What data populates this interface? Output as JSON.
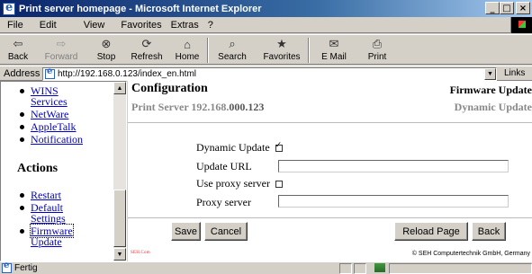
{
  "window": {
    "title": "Print server homepage - Microsoft Internet Explorer",
    "min_glyph": "_",
    "max_glyph": "□",
    "close_glyph": "×"
  },
  "menu": [
    "File",
    "Edit",
    "View",
    "Favorites",
    "Extras",
    "?"
  ],
  "toolbar": [
    {
      "label": "Back",
      "icon": "back-arrow-icon",
      "glyph": "⇦"
    },
    {
      "label": "Forward",
      "icon": "forward-arrow-icon",
      "glyph": "⇨",
      "disabled": true
    },
    {
      "label": "Stop",
      "icon": "stop-icon",
      "glyph": "⊗"
    },
    {
      "label": "Refresh",
      "icon": "refresh-icon",
      "glyph": "⟳"
    },
    {
      "label": "Home",
      "icon": "home-icon",
      "glyph": "⌂"
    },
    {
      "label": "Search",
      "icon": "search-icon",
      "glyph": "⌕"
    },
    {
      "label": "Favorites",
      "icon": "favorites-icon",
      "glyph": "★"
    },
    {
      "label": "E Mail",
      "icon": "mail-icon",
      "glyph": "✉"
    },
    {
      "label": "Print",
      "icon": "printer-icon",
      "glyph": "⎙"
    }
  ],
  "address": {
    "label": "Address",
    "url": "http://192.168.0.123/index_en.html",
    "links": "Links",
    "drop_glyph": "▼"
  },
  "nav": {
    "items": [
      {
        "line1": "WINS",
        "line2": "Services"
      },
      {
        "line1": "NetWare"
      },
      {
        "line1": "AppleTalk"
      },
      {
        "line1": "Notification"
      }
    ],
    "actions_heading": "Actions",
    "actions": [
      {
        "line1": "Restart"
      },
      {
        "line1": "Default",
        "line2": "Settings"
      },
      {
        "line1": "Firmware",
        "line2": "Update",
        "focused": true
      }
    ],
    "scroll_up": "▲",
    "scroll_down": "▼"
  },
  "content": {
    "heading": "Configuration",
    "section": "Firmware Update",
    "server_label": "Print Server",
    "server_ip_prefix": "192.168.",
    "server_ip_suffix": "000.123",
    "subsection": "Dynamic Update",
    "fields": {
      "dynamic_update": {
        "label": "Dynamic Update",
        "checked": true
      },
      "update_url": {
        "label": "Update URL",
        "value": ""
      },
      "use_proxy": {
        "label": "Use proxy server",
        "checked": false
      },
      "proxy_server": {
        "label": "Proxy server",
        "value": ""
      }
    },
    "buttons": {
      "save": "Save",
      "cancel": "Cancel",
      "reload": "Reload Page",
      "back": "Back"
    },
    "logo_text": "SEH.Com",
    "copyright": "© SEH Computertechnik GmbH, Germany"
  },
  "status": {
    "text": "Fertig"
  }
}
